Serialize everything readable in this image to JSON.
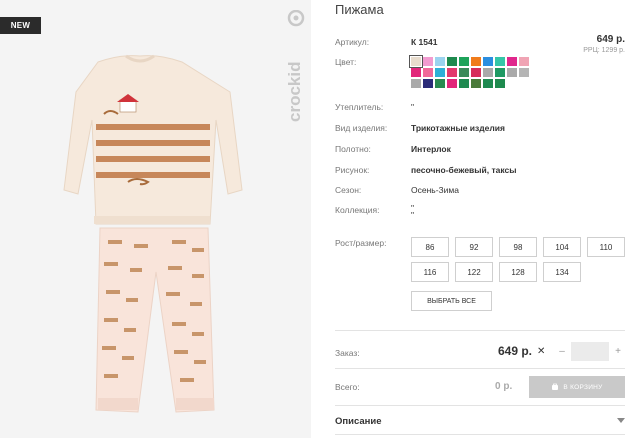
{
  "badge": "NEW",
  "logo_text": "crockid",
  "product": {
    "title": "Пижама",
    "price": "649 р.",
    "rrp": "РРЦ: 1299 р."
  },
  "attributes": {
    "article_label": "Артикул:",
    "article_value": "К 1541",
    "color_label": "Цвет:",
    "insulation_label": "Утеплитель:",
    "insulation_value": "\"",
    "type_label": "Вид изделия:",
    "type_value": "Трикотажные изделия",
    "fabric_label": "Полотно:",
    "fabric_value": "Интерлок",
    "pattern_label": "Рисунок:",
    "pattern_value": "песочно-бежевый, таксы",
    "season_label": "Сезон:",
    "season_value": "Осень-Зима",
    "collection_label": "Коллекция:",
    "collection_value": "\"\n\""
  },
  "swatches": [
    "#e8dccd",
    "#f29bd0",
    "#9bd3ef",
    "#1e8a4e",
    "#1ea35a",
    "#f07c1c",
    "#2b8ee0",
    "#35c6a8",
    "#e0278c",
    "#f0a4b4",
    "#e2267a",
    "#f0689a",
    "#2db0d6",
    "#e23a6d",
    "#3b8a5a",
    "#d62e5a",
    "#a9a9a9",
    "#1e9a63",
    "#aaaaaa",
    "#b5b5b5",
    "#aaaaaa",
    "#2b2b78",
    "#2a8a50",
    "#e2267a",
    "#1f8a50",
    "#4a7a3a",
    "#1f8a50",
    "#1e8a4e"
  ],
  "size_label": "Рост/размер:",
  "sizes": [
    "86",
    "92",
    "98",
    "104",
    "110",
    "116",
    "122",
    "128",
    "134"
  ],
  "select_all": "ВЫБРАТЬ ВСЕ",
  "order": {
    "label": "Заказ:",
    "price": "649 р.",
    "times": "✕",
    "minus": "–",
    "plus": "+",
    "quantity": ""
  },
  "total": {
    "label": "Всего:",
    "value": "0 р.",
    "cart_button": "В КОРЗИНУ"
  },
  "description_label": "Описание",
  "colors": {
    "accent": "#c9c9c9",
    "badge_bg": "#2b2b2b"
  }
}
